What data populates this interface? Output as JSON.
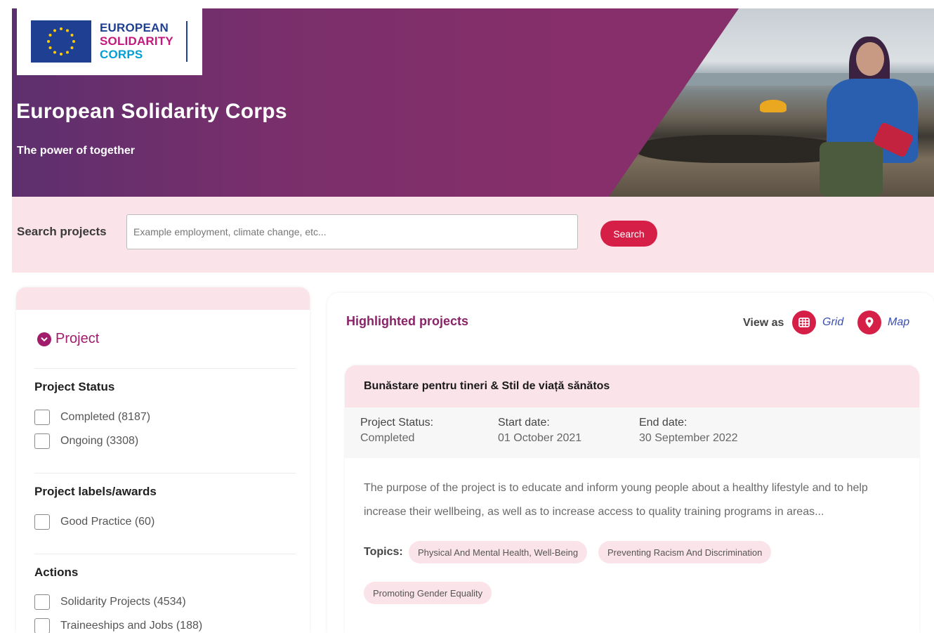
{
  "hero": {
    "logo_line1": "EUROPEAN",
    "logo_line2": "SOLIDARITY",
    "logo_line3": "CORPS",
    "title": "European Solidarity Corps",
    "subtitle": "The power of together"
  },
  "search": {
    "label": "Search projects",
    "placeholder": "Example employment, climate change, etc...",
    "button": "Search"
  },
  "filters": {
    "section_title": "Project",
    "groups": [
      {
        "title": "Project Status",
        "options": [
          "Completed (8187)",
          "Ongoing (3308)"
        ]
      },
      {
        "title": "Project labels/awards",
        "options": [
          "Good Practice (60)"
        ]
      },
      {
        "title": "Actions",
        "options": [
          "Solidarity Projects (4534)",
          "Traineeships and Jobs (188)"
        ]
      }
    ]
  },
  "main": {
    "title": "Highlighted projects",
    "view_as": "View as",
    "view_grid": "Grid",
    "view_map": "Map"
  },
  "card": {
    "title": "Bunăstare pentru tineri & Stil de viață sănătos",
    "status_label": "Project Status:",
    "status_value": "Completed",
    "start_label": "Start date:",
    "start_value": "01 October 2021",
    "end_label": "End date:",
    "end_value": "30 September 2022",
    "description": "The purpose of the project is to educate and inform young people about a healthy lifestyle and to help increase their wellbeing, as well as to increase access to quality training programs in areas...",
    "topics_label": "Topics:",
    "topics": [
      "Physical And Mental Health, Well-Being",
      "Preventing Racism And Discrimination",
      "Promoting Gender Equality"
    ]
  },
  "colors": {
    "brand_purple": "#862f6a",
    "accent_red": "#d61f46",
    "pink_band": "#fbe3ea",
    "title_magenta": "#8a2468"
  },
  "icons": {
    "section_toggle": "chevron-down-circle-icon",
    "grid_view": "grid-icon",
    "map_view": "map-pin-icon",
    "logo_flag": "eu-flag-icon"
  }
}
